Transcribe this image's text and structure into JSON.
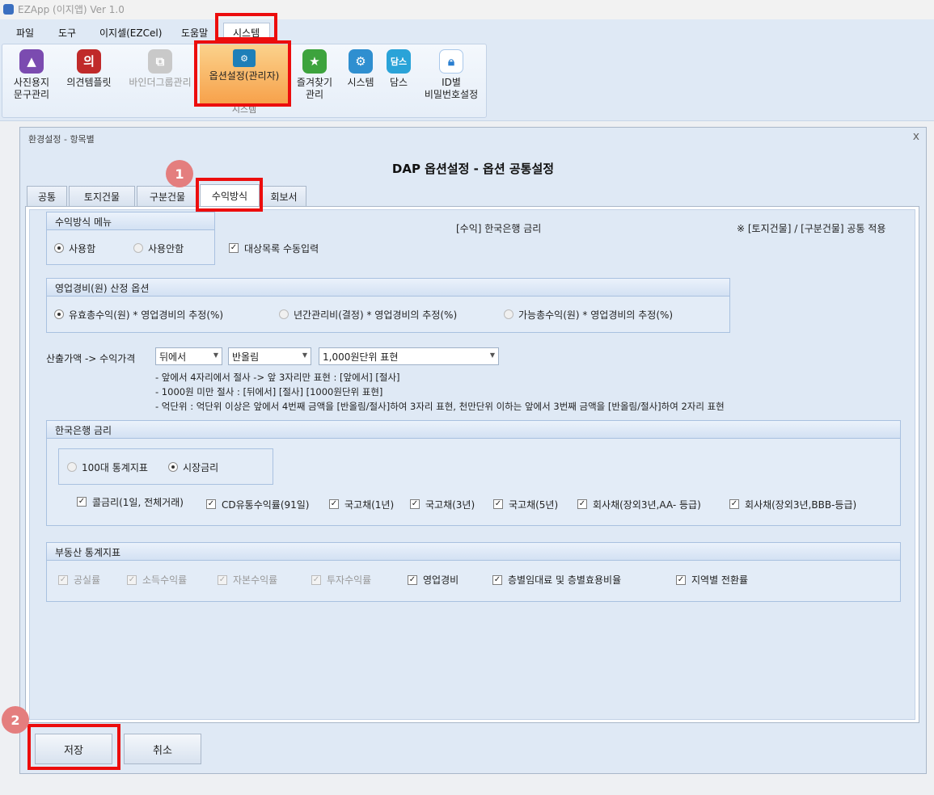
{
  "app": {
    "title": "EZApp (이지앱)  Ver 1.0"
  },
  "menu": [
    {
      "label": "파일"
    },
    {
      "label": "도구"
    },
    {
      "label": "이지셀(EZCel)"
    },
    {
      "label": "도움말"
    },
    {
      "label": "시스템"
    }
  ],
  "ribbon": {
    "group_label": "시스템",
    "buttons": [
      {
        "label1": "사진용지",
        "label2": "문구관리",
        "icon": "photo-paper-icon"
      },
      {
        "label1": "의견템플릿",
        "label2": "",
        "icon": "opinion-template-icon"
      },
      {
        "label1": "바인더그룹관리",
        "label2": "",
        "icon": "binder-group-icon"
      },
      {
        "label1": "옵션설정(관리자)",
        "label2": "",
        "icon": "option-settings-icon"
      },
      {
        "label1": "즐겨찾기",
        "label2": "관리",
        "icon": "favorites-icon"
      },
      {
        "label1": "시스템",
        "label2": "",
        "icon": "gear-icon"
      },
      {
        "label1": "담스",
        "label2": "",
        "icon": "dams-icon"
      },
      {
        "label1": "ID별",
        "label2": "비밀번호설정",
        "icon": "lock-icon"
      }
    ]
  },
  "dialog": {
    "title": "환경설정 - 항목별",
    "close": "x",
    "heading": "DAP 옵션설정 - 옵션 공통설정",
    "tabs": [
      {
        "label": "공통"
      },
      {
        "label": "토지건물"
      },
      {
        "label": "구분건물"
      },
      {
        "label": "수익방식"
      },
      {
        "label": "회보서"
      }
    ]
  },
  "income_menu": {
    "title": "수익방식 메뉴",
    "use": "사용함",
    "nouse": "사용안함",
    "selected": "사용함",
    "manual_input": "대상목록 수동입력",
    "manual_input_checked": true
  },
  "info_labels": {
    "rate_label": "[수익] 한국은행 금리",
    "note": "※ [토지건물] / [구분건물] 공통 적용"
  },
  "op_expense": {
    "title": "영업경비(원) 산정 옵션",
    "options": [
      "유효총수익(원) * 영업경비의 추정(%)",
      "년간관리비(결정) * 영업경비의 추정(%)",
      "가능총수익(원) * 영업경비의 추정(%)"
    ],
    "selected_index": 0
  },
  "conversion": {
    "label": "산출가액 -> 수익가격",
    "combo1": "뒤에서",
    "combo2": "반올림",
    "combo3": "1,000원단위 표현",
    "notes": [
      "- 앞에서 4자리에서 절사 -> 앞 3자리만 표현 : [앞에서] [절사]",
      "- 1000원 미만 절사 : [뒤에서] [절사] [1000원단위 표현]",
      "- 억단위 : 억단위 이상은 앞에서 4번째 금액을 [반올림/절사]하여 3자리 표현, 천만단위 이하는 앞에서 3번째 금액을 [반올림/절사]하여 2자리 표현"
    ]
  },
  "bok": {
    "title": "한국은행 금리",
    "radio1": "100대 통계지표",
    "radio2": "시장금리",
    "selected": "시장금리",
    "checks": [
      {
        "label": "콜금리(1일, 전체거래)",
        "checked": true
      },
      {
        "label": "CD유통수익률(91일)",
        "checked": true
      },
      {
        "label": "국고채(1년)",
        "checked": true
      },
      {
        "label": "국고채(3년)",
        "checked": true
      },
      {
        "label": "국고채(5년)",
        "checked": true
      },
      {
        "label": "회사채(장외3년,AA- 등급)",
        "checked": true
      },
      {
        "label": "회사채(장외3년,BBB-등급)",
        "checked": true
      }
    ]
  },
  "realestate": {
    "title": "부동산 통계지표",
    "checks": [
      {
        "label": "공실률",
        "checked": true,
        "disabled": true
      },
      {
        "label": "소득수익률",
        "checked": true,
        "disabled": true
      },
      {
        "label": "자본수익률",
        "checked": true,
        "disabled": true
      },
      {
        "label": "투자수익률",
        "checked": true,
        "disabled": true
      },
      {
        "label": "영업경비",
        "checked": true,
        "disabled": false
      },
      {
        "label": "층별임대료 및 층별효용비율",
        "checked": true,
        "disabled": false
      },
      {
        "label": "지역별 전환률",
        "checked": true,
        "disabled": false
      }
    ]
  },
  "buttons": {
    "save": "저장",
    "cancel": "취소"
  },
  "badges": {
    "step1": "1",
    "step2": "2"
  },
  "colors": {
    "highlight": "#ec0d0d",
    "badge": "#e47e7e",
    "ribbon_active": "#f7a14a"
  }
}
